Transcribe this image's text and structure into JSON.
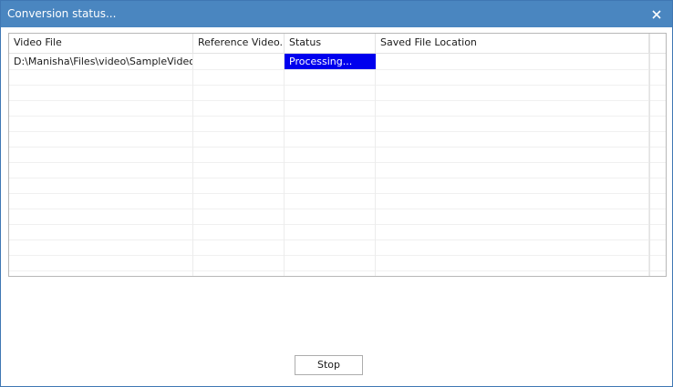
{
  "window": {
    "title": "Conversion status...",
    "close_glyph": "✕"
  },
  "table": {
    "columns": [
      "Video File",
      "Reference Video...",
      "Status",
      "Saved File Location"
    ],
    "rows": [
      {
        "video_file": "D:\\Manisha\\Files\\video\\SampleVideo_...",
        "reference_video": "",
        "status": "Processing...",
        "saved_file_location": ""
      }
    ],
    "status_highlight_color": "#0000ee"
  },
  "actions": {
    "stop_label": "Stop"
  },
  "colors": {
    "titlebar": "#4a86c0",
    "window_border": "#3f77b3"
  }
}
